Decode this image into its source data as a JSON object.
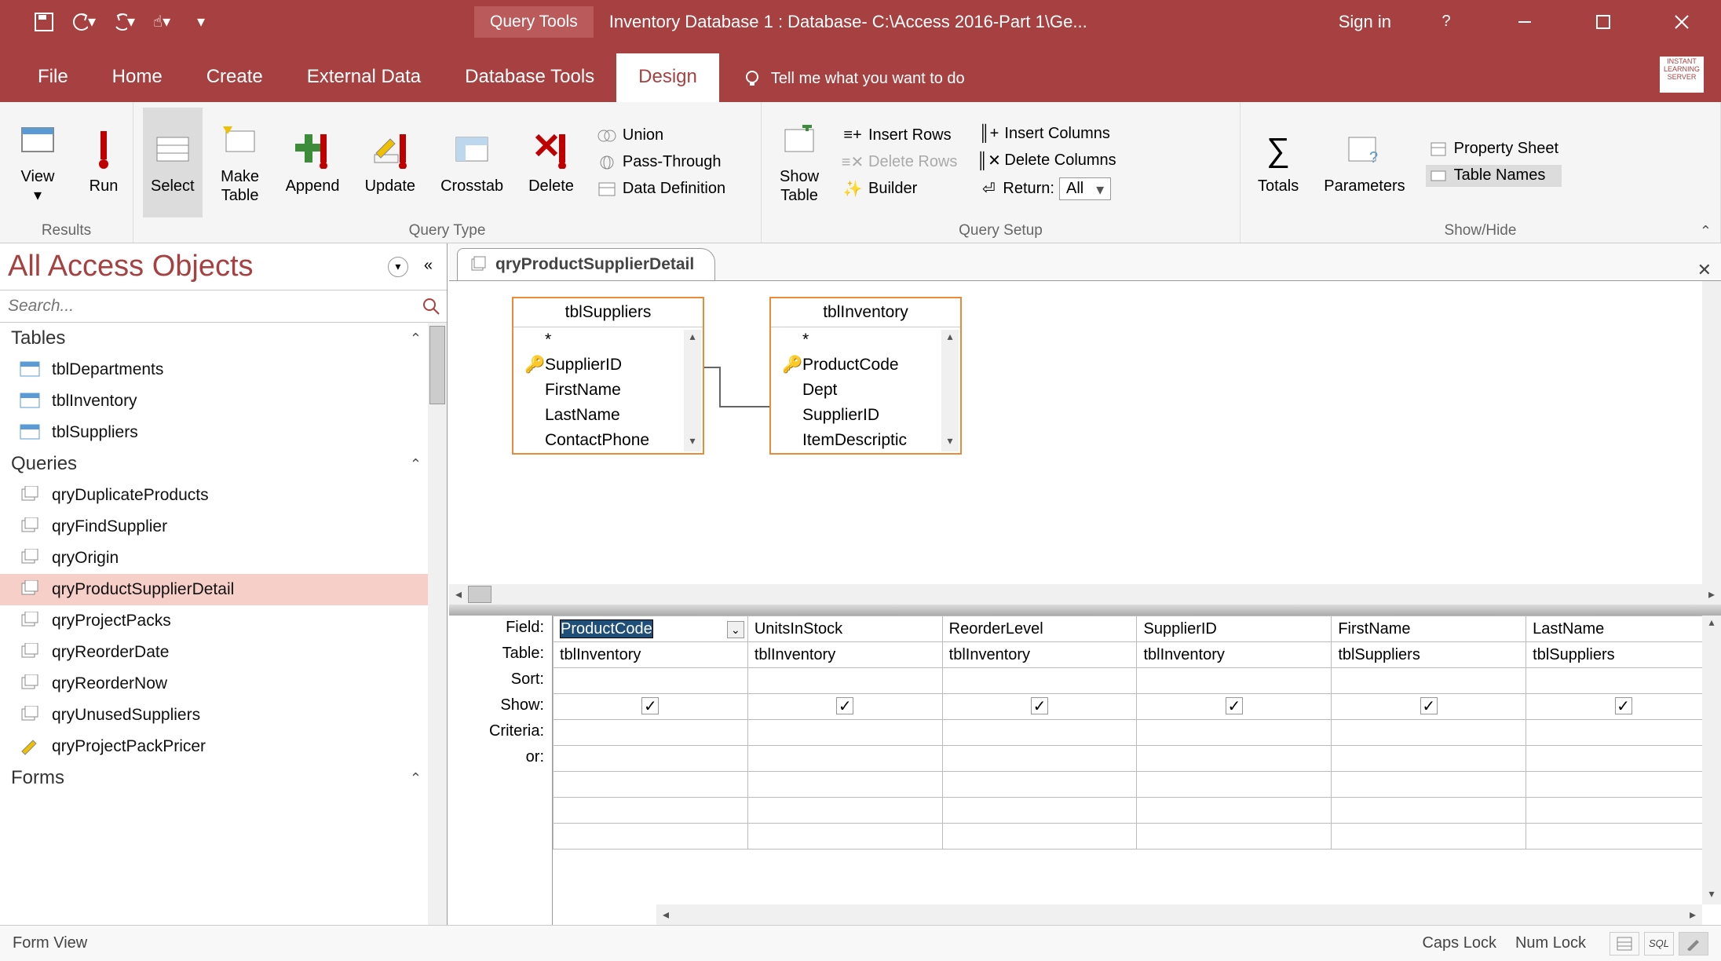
{
  "title": "Inventory Database 1 : Database- C:\\Access 2016-Part 1\\Ge...",
  "context_tab": "Query Tools",
  "signin": "Sign in",
  "tabs": [
    "File",
    "Home",
    "Create",
    "External Data",
    "Database Tools",
    "Design"
  ],
  "active_tab": "Design",
  "tellme": "Tell me what you want to do",
  "ribbon": {
    "results": {
      "label": "Results",
      "view": "View",
      "run": "Run"
    },
    "querytype": {
      "label": "Query Type",
      "select": "Select",
      "make": "Make\nTable",
      "append": "Append",
      "update": "Update",
      "crosstab": "Crosstab",
      "delete": "Delete",
      "union": "Union",
      "passthrough": "Pass-Through",
      "datadef": "Data Definition"
    },
    "querysetup": {
      "label": "Query Setup",
      "show": "Show\nTable",
      "insrows": "Insert Rows",
      "delrows": "Delete Rows",
      "builder": "Builder",
      "inscols": "Insert Columns",
      "delcols": "Delete Columns",
      "return": "Return:",
      "return_val": "All"
    },
    "showhide": {
      "label": "Show/Hide",
      "totals": "Totals",
      "params": "Parameters",
      "prop": "Property Sheet",
      "tablenames": "Table Names"
    }
  },
  "nav": {
    "title": "All Access Objects",
    "search_ph": "Search...",
    "cats": {
      "tables": "Tables",
      "queries": "Queries",
      "forms": "Forms"
    },
    "tables": [
      "tblDepartments",
      "tblInventory",
      "tblSuppliers"
    ],
    "queries": [
      "qryDuplicateProducts",
      "qryFindSupplier",
      "qryOrigin",
      "qryProductSupplierDetail",
      "qryProjectPacks",
      "qryReorderDate",
      "qryReorderNow",
      "qryUnusedSuppliers",
      "qryProjectPackPricer"
    ],
    "selected_query": "qryProductSupplierDetail"
  },
  "doc": {
    "tab": "qryProductSupplierDetail"
  },
  "design_tables": {
    "suppliers": {
      "title": "tblSuppliers",
      "fields": [
        "*",
        "SupplierID",
        "FirstName",
        "LastName",
        "ContactPhone"
      ],
      "key_idx": 1
    },
    "inventory": {
      "title": "tblInventory",
      "fields": [
        "*",
        "ProductCode",
        "Dept",
        "SupplierID",
        "ItemDescriptic"
      ],
      "key_idx": 1
    }
  },
  "grid": {
    "rows": [
      "Field:",
      "Table:",
      "Sort:",
      "Show:",
      "Criteria:",
      "or:"
    ],
    "cols": [
      {
        "field": "ProductCode",
        "table": "tblInventory",
        "show": true,
        "selected": true
      },
      {
        "field": "UnitsInStock",
        "table": "tblInventory",
        "show": true
      },
      {
        "field": "ReorderLevel",
        "table": "tblInventory",
        "show": true
      },
      {
        "field": "SupplierID",
        "table": "tblInventory",
        "show": true
      },
      {
        "field": "FirstName",
        "table": "tblSuppliers",
        "show": true
      },
      {
        "field": "LastName",
        "table": "tblSuppliers",
        "show": true
      }
    ]
  },
  "status": {
    "left": "Form View",
    "caps": "Caps Lock",
    "num": "Num Lock",
    "sql": "SQL"
  }
}
